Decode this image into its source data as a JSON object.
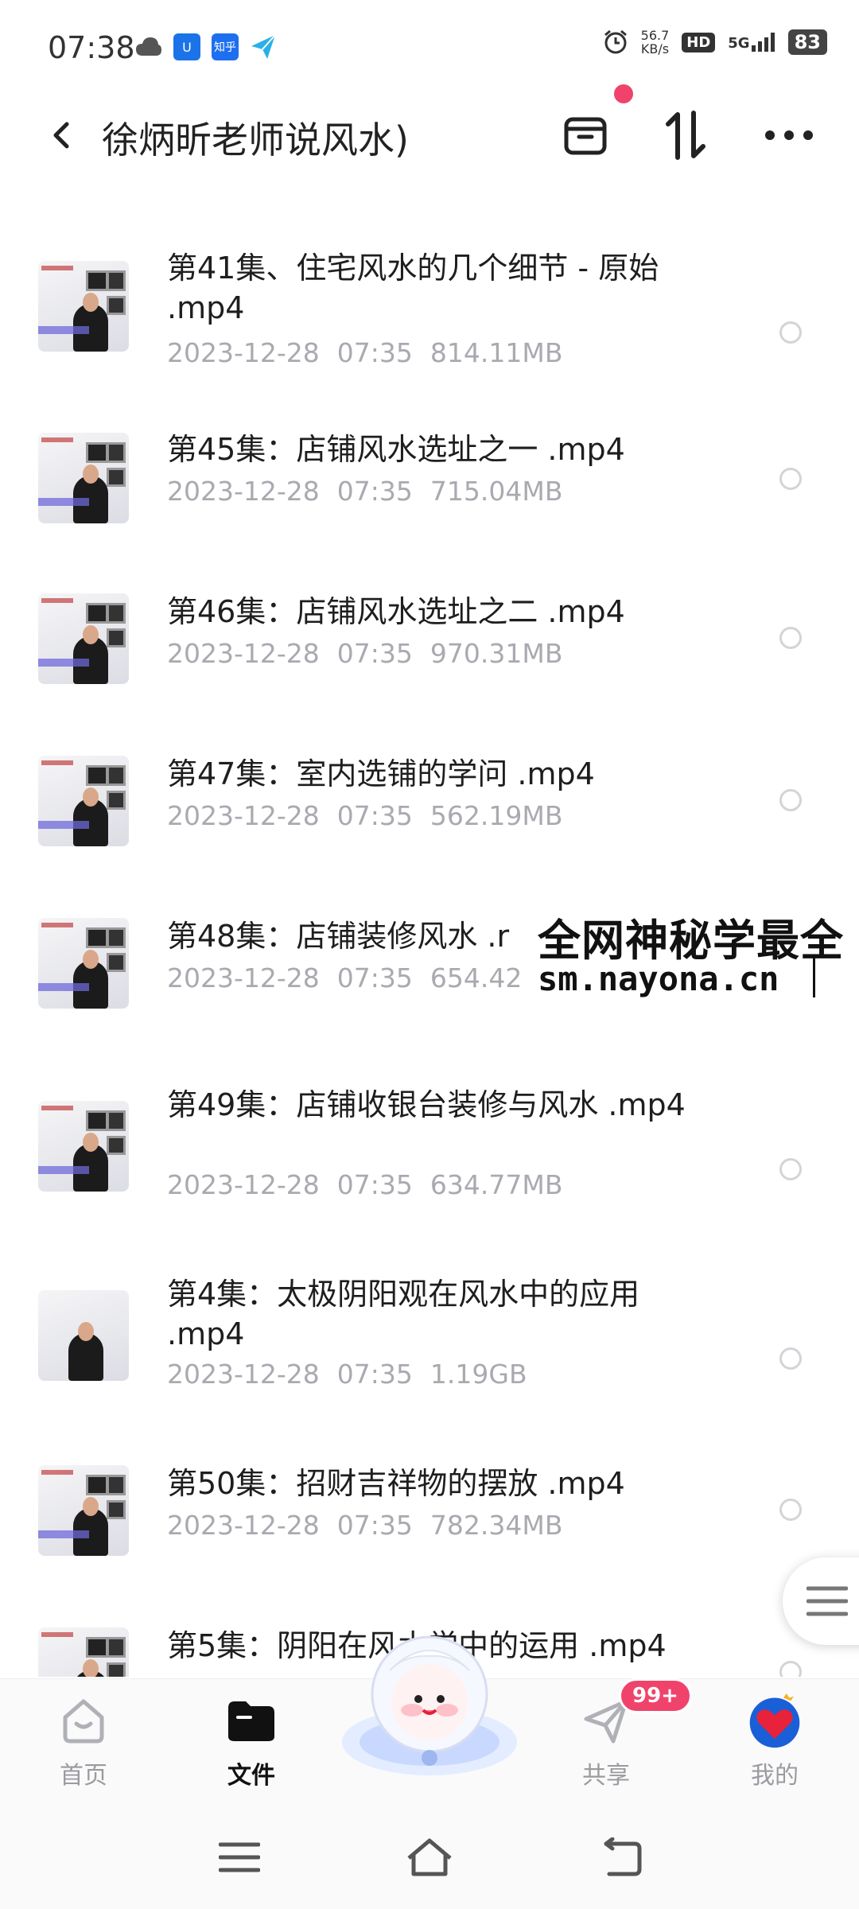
{
  "status_bar": {
    "time": "07:38",
    "app_icon_1": "U",
    "app_icon_2": "知乎",
    "speed_value": "56.7",
    "speed_unit": "KB/s",
    "hd": "HD",
    "network": "5G",
    "battery": "83"
  },
  "header": {
    "title": "徐炳昕老师说风水)"
  },
  "files": [
    {
      "name": "第41集、住宅风水的几个细节 - 原始 .mp4",
      "date": "2023-12-28",
      "time": "07:35",
      "size": "814.11MB"
    },
    {
      "name": "第45集：店铺风水选址之一 .mp4",
      "date": "2023-12-28",
      "time": "07:35",
      "size": "715.04MB"
    },
    {
      "name": "第46集：店铺风水选址之二 .mp4",
      "date": "2023-12-28",
      "time": "07:35",
      "size": "970.31MB"
    },
    {
      "name": "第47集：室内选铺的学问 .mp4",
      "date": "2023-12-28",
      "time": "07:35",
      "size": "562.19MB"
    },
    {
      "name": "第48集：店铺装修风水 .r",
      "date": "2023-12-28",
      "time": "07:35",
      "size": "654.42"
    },
    {
      "name": "第49集：店铺收银台装修与风水 .mp4",
      "date": "2023-12-28",
      "time": "07:35",
      "size": "634.77MB"
    },
    {
      "name": "第4集：太极阴阳观在风水中的应用 .mp4",
      "date": "2023-12-28",
      "time": "07:35",
      "size": "1.19GB"
    },
    {
      "name": "第50集：招财吉祥物的摆放 .mp4",
      "date": "2023-12-28",
      "time": "07:35",
      "size": "782.34MB"
    },
    {
      "name": "第5集：阴阳在风水学中的运用 .mp4",
      "date": "",
      "time": "",
      "size": ""
    }
  ],
  "watermark": {
    "line1": "全网神秘学最全",
    "line2": "sm.nayona.cn"
  },
  "bottom_nav": {
    "tabs": [
      {
        "label": "首页",
        "icon": "home-icon"
      },
      {
        "label": "文件",
        "icon": "folder-icon"
      },
      {
        "label": "共享",
        "icon": "send-icon"
      },
      {
        "label": "我的",
        "icon": "avatar-icon"
      }
    ],
    "share_badge": "99+"
  },
  "colors": {
    "accent": "#f0436b",
    "meta_text": "#a9aab0"
  }
}
